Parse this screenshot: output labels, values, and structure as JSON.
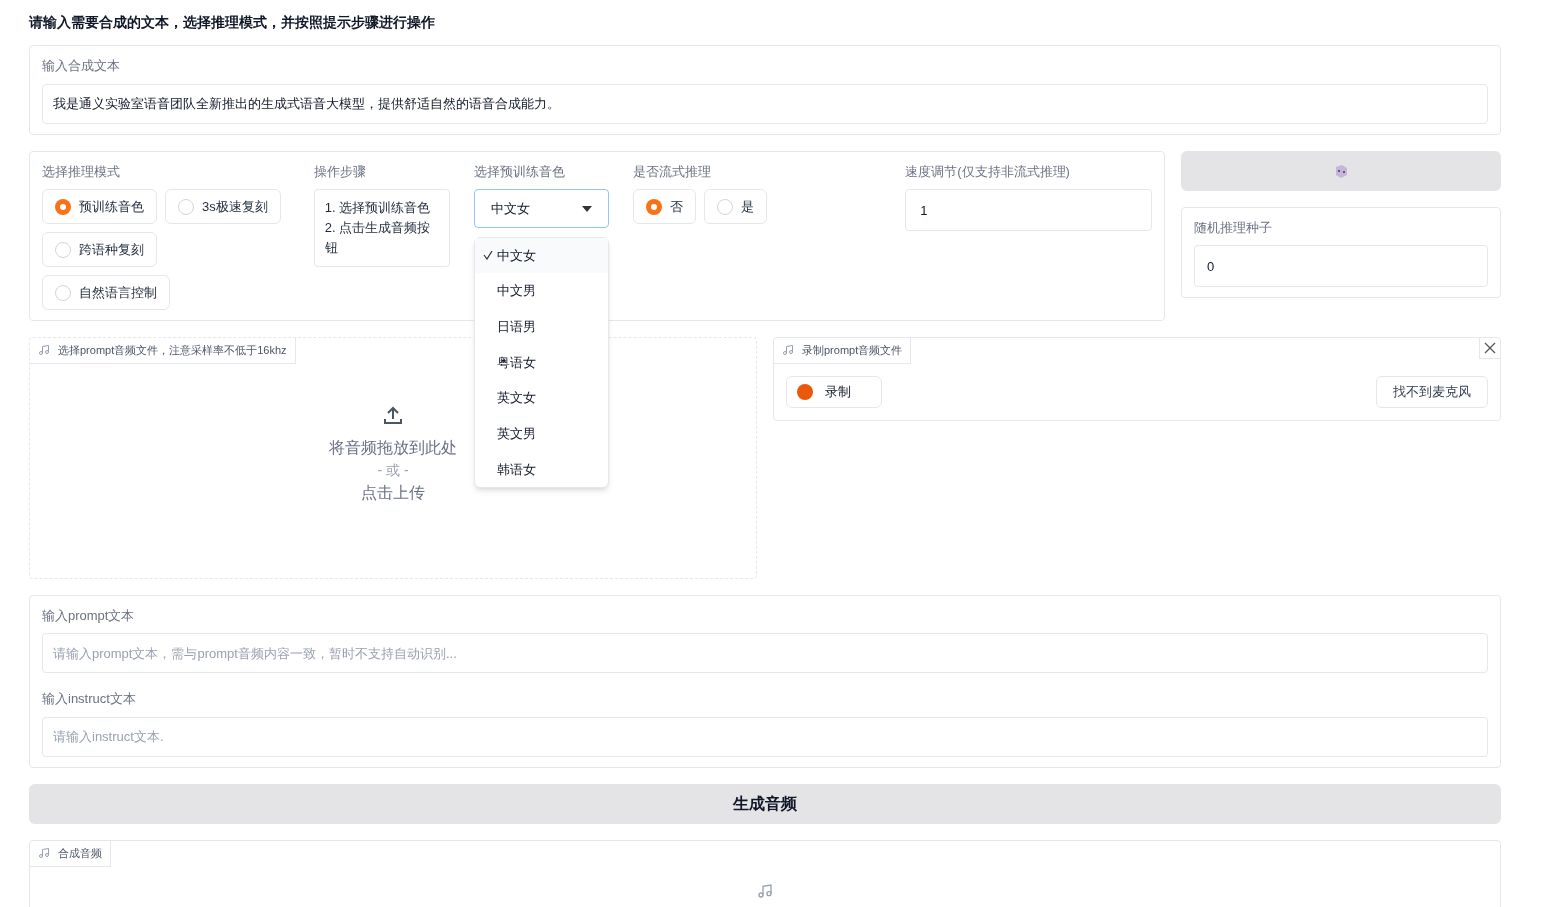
{
  "heading": "请输入需要合成的文本，选择推理模式，并按照提示步骤进行操作",
  "tts_text": {
    "label": "输入合成文本",
    "value": "我是通义实验室语音团队全新推出的生成式语音大模型，提供舒适自然的语音合成能力。"
  },
  "mode": {
    "label": "选择推理模式",
    "options": [
      {
        "label": "预训练音色",
        "selected": true
      },
      {
        "label": "3s极速复刻",
        "selected": false
      },
      {
        "label": "跨语种复刻",
        "selected": false
      },
      {
        "label": "自然语言控制",
        "selected": false
      }
    ]
  },
  "steps": {
    "label": "操作步骤",
    "lines": [
      "1. 选择预训练音色",
      "2. 点击生成音频按钮"
    ]
  },
  "voice": {
    "label": "选择预训练音色",
    "value": "中文女",
    "expanded": true,
    "options": [
      {
        "label": "中文女",
        "selected": true
      },
      {
        "label": "中文男",
        "selected": false
      },
      {
        "label": "日语男",
        "selected": false
      },
      {
        "label": "粤语女",
        "selected": false
      },
      {
        "label": "英文女",
        "selected": false
      },
      {
        "label": "英文男",
        "selected": false
      },
      {
        "label": "韩语女",
        "selected": false
      }
    ]
  },
  "stream": {
    "label": "是否流式推理",
    "options": [
      {
        "label": "否",
        "selected": true
      },
      {
        "label": "是",
        "selected": false
      }
    ]
  },
  "speed": {
    "label": "速度调节(仅支持非流式推理)",
    "value": "1"
  },
  "seed": {
    "label": "随机推理种子",
    "value": "0"
  },
  "upload": {
    "label": "选择prompt音频文件，注意采样率不低于16khz",
    "drop_text": "将音频拖放到此处",
    "or_text": "- 或 -",
    "click_text": "点击上传"
  },
  "record": {
    "label": "录制prompt音频文件",
    "record_button": "录制",
    "mic_button": "找不到麦克风"
  },
  "prompt_text": {
    "label": "输入prompt文本",
    "placeholder": "请输入prompt文本，需与prompt音频内容一致，暂时不支持自动识别..."
  },
  "instruct_text": {
    "label": "输入instruct文本",
    "placeholder": "请输入instruct文本."
  },
  "generate_button": "生成音频",
  "output": {
    "label": "合成音频"
  }
}
